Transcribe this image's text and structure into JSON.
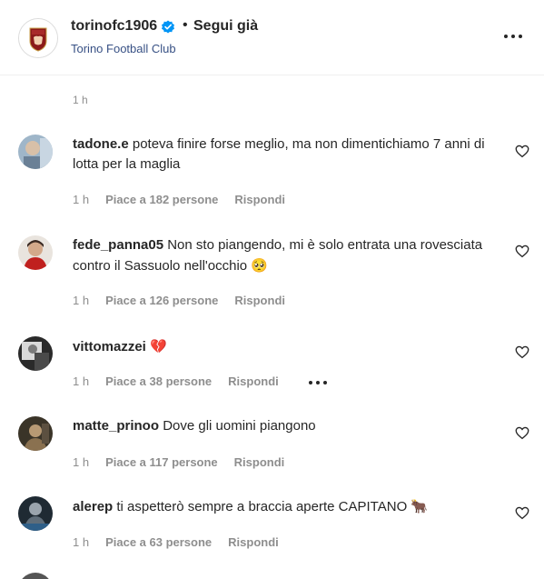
{
  "header": {
    "username": "torinofc1906",
    "dot": "•",
    "follow_label": "Segui già",
    "subtitle": "Torino Football Club"
  },
  "top_time": "1 h",
  "comments": [
    {
      "username": "tadone.e",
      "text": "poteva finire forse meglio, ma non dimentichiamo 7 anni di lotta per la maglia",
      "time": "1 h",
      "likes": "Piace a 182 persone",
      "reply": "Rispondi"
    },
    {
      "username": "fede_panna05",
      "text": "Non sto piangendo, mi è solo entrata una rovesciata contro il Sassuolo nell'occhio",
      "emoji": "🥺",
      "time": "1 h",
      "likes": "Piace a 126 persone",
      "reply": "Rispondi"
    },
    {
      "username": "vittomazzei",
      "text": "",
      "emoji": "💔",
      "time": "1 h",
      "likes": "Piace a 38 persone",
      "reply": "Rispondi"
    },
    {
      "username": "matte_prinoo",
      "text": "Dove gli uomini piangono",
      "time": "1 h",
      "likes": "Piace a 117 persone",
      "reply": "Rispondi"
    },
    {
      "username": "alerep",
      "text": "ti aspetterò sempre a braccia aperte CAPITANO",
      "emoji": "🐂",
      "time": "1 h",
      "likes": "Piace a 63 persone",
      "reply": "Rispondi"
    }
  ],
  "colors": {
    "text": "#262626",
    "muted": "#8e8e8e",
    "link": "#385185",
    "verified": "#0095f6",
    "torino_red": "#8b1a1a"
  },
  "icons": [
    "torino-crest-icon",
    "verified-badge-icon",
    "more-options-icon",
    "heart-icon"
  ]
}
